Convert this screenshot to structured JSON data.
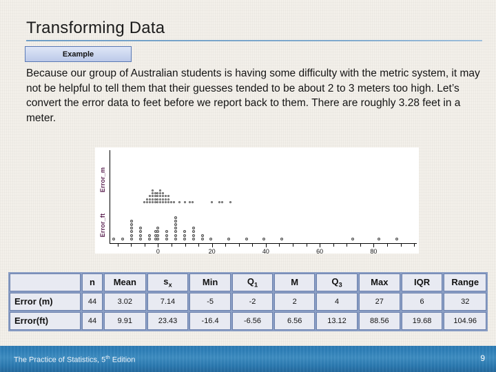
{
  "slide": {
    "title": "Transforming Data",
    "badge_label": "Example",
    "body_text": "Because our group of Australian students is having some difficulty with the metric system, it may not be helpful to tell them that their guesses tended to be about 2 to 3 meters too high. Let’s convert the error data to feet before we report back to them. There are roughly 3.28 feet in a meter.",
    "accent_color": "#6e9dc6",
    "badge_border_color": "#5878b4"
  },
  "chart_data": {
    "type": "scatter",
    "title": "",
    "xlabel": "",
    "ylabel": "",
    "grid": false,
    "legend": "none",
    "axis_label_color": "#5a2050",
    "xlim": [
      -18,
      96
    ],
    "xticks": [
      0,
      20,
      40,
      60,
      80
    ],
    "xtick_labels": [
      "0",
      "20",
      "40",
      "60",
      "80"
    ],
    "minor_tick_step": 5,
    "series": [
      {
        "name": "Error_m",
        "row": "top",
        "x": [
          -5,
          -4,
          -4,
          -3,
          -3,
          -3,
          -2,
          -2,
          -2,
          -2,
          -2,
          -1,
          -1,
          -1,
          -1,
          0,
          0,
          0,
          0,
          1,
          1,
          1,
          1,
          1,
          2,
          2,
          2,
          2,
          3,
          3,
          3,
          4,
          4,
          4,
          5,
          6,
          8,
          10,
          12,
          13,
          20,
          23,
          24,
          27
        ]
      },
      {
        "name": "Error_ft",
        "row": "bottom",
        "x": [
          -16.4,
          -13.12,
          -9.84,
          -9.84,
          -9.84,
          -9.84,
          -9.84,
          -9.84,
          -6.56,
          -6.56,
          -6.56,
          -6.56,
          -3.28,
          -3.28,
          -1.0,
          -1.0,
          -1.0,
          0,
          0,
          0,
          0,
          3.28,
          3.28,
          3.28,
          6.56,
          6.56,
          6.56,
          6.56,
          6.56,
          6.56,
          6.56,
          9.84,
          9.84,
          9.84,
          13.12,
          13.12,
          13.12,
          13.12,
          16.4,
          16.4,
          19.68,
          26.24,
          32.8,
          39.36,
          45.92,
          72.16,
          82.0,
          88.56
        ]
      }
    ]
  },
  "table": {
    "headers": [
      "",
      "n",
      "Mean",
      "s",
      "Min",
      "Q",
      "M",
      "Q",
      "Max",
      "IQR",
      "Range"
    ],
    "header_labels": {
      "blank": "",
      "n": "n",
      "mean": "Mean",
      "sx_base": "s",
      "sx_sub": "x",
      "min": "Min",
      "q1_base": "Q",
      "q1_sub": "1",
      "m": "M",
      "q3_base": "Q",
      "q3_sub": "3",
      "max": "Max",
      "iqr": "IQR",
      "range": "Range"
    },
    "rows": [
      {
        "label": "Error (m)",
        "n": "44",
        "mean": "3.02",
        "sx": "7.14",
        "min": "-5",
        "q1": "-2",
        "m": "2",
        "q3": "4",
        "max": "27",
        "iqr": "6",
        "range": "32"
      },
      {
        "label": "Error(ft)",
        "n": "44",
        "mean": "9.91",
        "sx": "23.43",
        "min": "-16.4",
        "q1": "-6.56",
        "m": "6.56",
        "q3": "13.12",
        "max": "88.56",
        "iqr": "19.68",
        "range": "104.96"
      }
    ]
  },
  "footer": {
    "text_main": "The Practice of Statistics, 5",
    "text_sup": "th",
    "text_tail": " Edition",
    "page_number": "9",
    "bar_color": "#2f7cb4"
  }
}
